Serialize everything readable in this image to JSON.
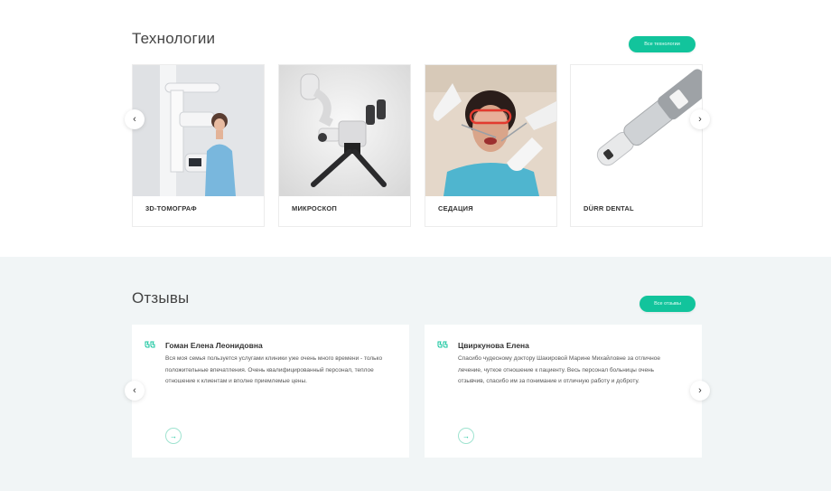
{
  "technologies": {
    "title": "Технологии",
    "all_button": "Все технологии",
    "items": [
      {
        "label": "3D-ТОМОГРАФ"
      },
      {
        "label": "МИКРОСКОП"
      },
      {
        "label": "СЕДАЦИЯ"
      },
      {
        "label": "DÜRR DENTAL"
      }
    ],
    "prev_arrow": "‹",
    "next_arrow": "›"
  },
  "reviews": {
    "title": "Отзывы",
    "all_button": "Все отзывы",
    "items": [
      {
        "name": "Гоман Елена Леонидовна",
        "text": "Вся моя семья пользуется услугами клиники уже очень много времени - только положительные впечатления. Очень квалифицированный персонал, теплое отношение к клиентам и вполне приемлемые цены."
      },
      {
        "name": "Цвиркунова Елена",
        "text": "Спасибо чудесному доктору Шакировой Марине Михайловне за отличное лечение, чуткое отношение к пациенту. Весь персонал больницы очень отзывчив, спасибо им за понимание и отличную работу и доброту."
      }
    ],
    "prev_arrow": "‹",
    "next_arrow": "›",
    "more_arrow": "→"
  },
  "colors": {
    "accent": "#12c49c",
    "reviews_bg": "#f1f5f6"
  }
}
